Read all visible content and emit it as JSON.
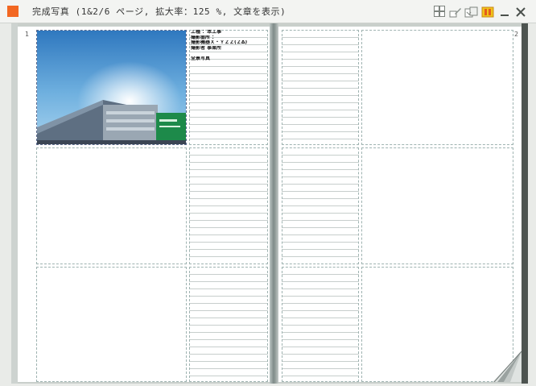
{
  "window": {
    "title": "完成写真 (1&2/6 ページ, 拡大率：125 %, 文章を表示)",
    "accent": "#f26722"
  },
  "toolbar": {
    "icons": [
      "layout-grid-icon",
      "pen-icon",
      "page-view-icon",
      "book-icon",
      "minimize-icon",
      "close-icon"
    ]
  },
  "pages": {
    "left_number": "1",
    "right_number": "2"
  },
  "memo": {
    "lines": [
      "工種 ：本工事",
      "撮影箇所 ：",
      "撮影機器Ｘ・ＹＺＺ(ＺΔ)",
      "撮影者 事業所",
      "",
      "全景写真"
    ]
  },
  "photo": {
    "subject": "building-photo"
  }
}
